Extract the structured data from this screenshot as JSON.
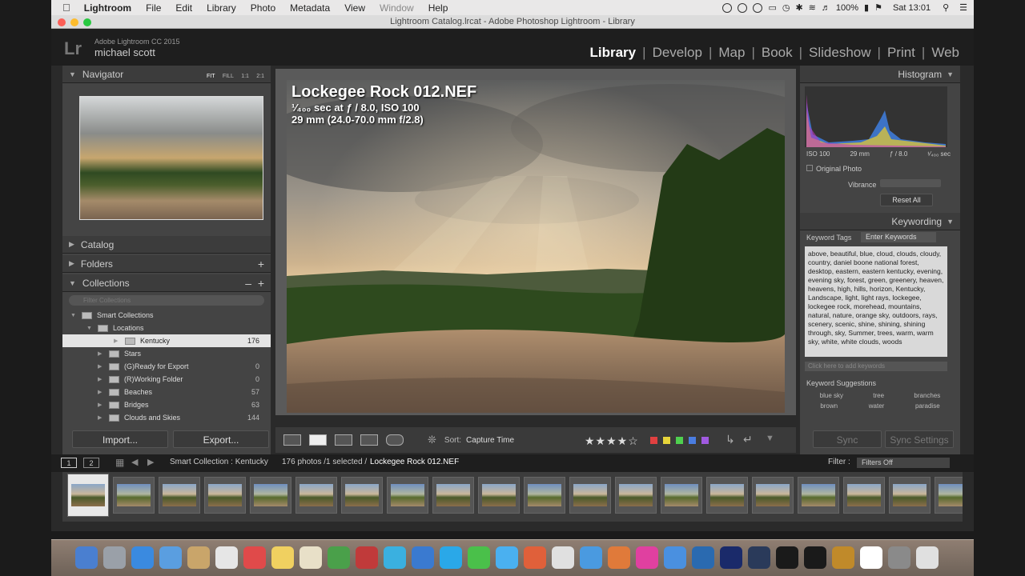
{
  "menubar": {
    "app": "Lightroom",
    "items": [
      "File",
      "Edit",
      "Library",
      "Photo",
      "Metadata",
      "View",
      "Window",
      "Help"
    ],
    "battery": "100%",
    "clock": "Sat 13:01"
  },
  "window": {
    "title": "Lightroom Catalog.lrcat - Adobe Photoshop Lightroom - Library"
  },
  "header": {
    "logo": "Lr",
    "product": "Adobe Lightroom CC 2015",
    "user": "michael scott",
    "modules": [
      "Library",
      "Develop",
      "Map",
      "Book",
      "Slideshow",
      "Print",
      "Web"
    ],
    "active_module": "Library"
  },
  "navigator": {
    "title": "Navigator",
    "zoom": [
      "FIT",
      "FILL",
      "1:1",
      "2:1"
    ]
  },
  "left_sections": {
    "catalog": "Catalog",
    "folders": "Folders",
    "collections": "Collections",
    "filter_placeholder": "Filter Collections"
  },
  "collections": [
    {
      "name": "Smart Collections",
      "count": ""
    },
    {
      "name": "Locations",
      "count": ""
    },
    {
      "name": "Kentucky",
      "count": "176"
    },
    {
      "name": "Stars",
      "count": ""
    },
    {
      "name": "(G)Ready for Export",
      "count": "0"
    },
    {
      "name": "(R)Working Folder",
      "count": "0"
    },
    {
      "name": "Beaches",
      "count": "57"
    },
    {
      "name": "Bridges",
      "count": "63"
    },
    {
      "name": "Clouds and Skies",
      "count": "144"
    }
  ],
  "left_buttons": {
    "import": "Import...",
    "export": "Export..."
  },
  "photo_info": {
    "filename": "Lockegee Rock 012.NEF",
    "exposure": "¹⁄₄₀₀ sec at ƒ / 8.0, ISO 100",
    "lens": "29 mm (24.0-70.0 mm f/2.8)"
  },
  "histogram": {
    "title": "Histogram",
    "iso": "ISO 100",
    "focal": "29 mm",
    "aperture": "ƒ / 8.0",
    "shutter": "¹⁄₄₀₀ sec",
    "original_photo": "Original Photo"
  },
  "quick_develop": {
    "vibrance": "Vibrance",
    "reset_all": "Reset All"
  },
  "keywording": {
    "title": "Keywording",
    "tags_label": "Keyword Tags",
    "tags_mode": "Enter Keywords",
    "keywords": "above, beautiful, blue, cloud, clouds, cloudy, country, daniel boone national forest, desktop, eastern, eastern kentucky, evening, evening sky, forest, green, greenery, heaven, heavens, high, hills, horizon, Kentucky, Landscape, light, light rays, lockegee, lockegee rock, morehead, mountains, natural, nature, orange sky, outdoors, rays, scenery, scenic, shine, shining, shining through, sky, Summer, trees, warm, warm sky, white, white clouds, woods",
    "add_placeholder": "Click here to add keywords",
    "suggestions_title": "Keyword Suggestions",
    "suggestions": [
      "blue sky",
      "tree",
      "branches",
      "brown",
      "water",
      "paradise"
    ]
  },
  "sync": {
    "sync": "Sync",
    "sync_settings": "Sync Settings"
  },
  "toolbar": {
    "sort_label": "Sort:",
    "sort_value": "Capture Time",
    "rating": 4
  },
  "filmstrip_bar": {
    "page1": "1",
    "page2": "2",
    "source": "Smart Collection : Kentucky",
    "count": "176 photos /1 selected /",
    "selected_file": "Lockegee Rock 012.NEF",
    "filter_label": "Filter :",
    "filter_value": "Filters Off"
  },
  "colors": {
    "accent": "#cfcfcf",
    "panel": "#444444",
    "bg": "#1b1b1b"
  }
}
